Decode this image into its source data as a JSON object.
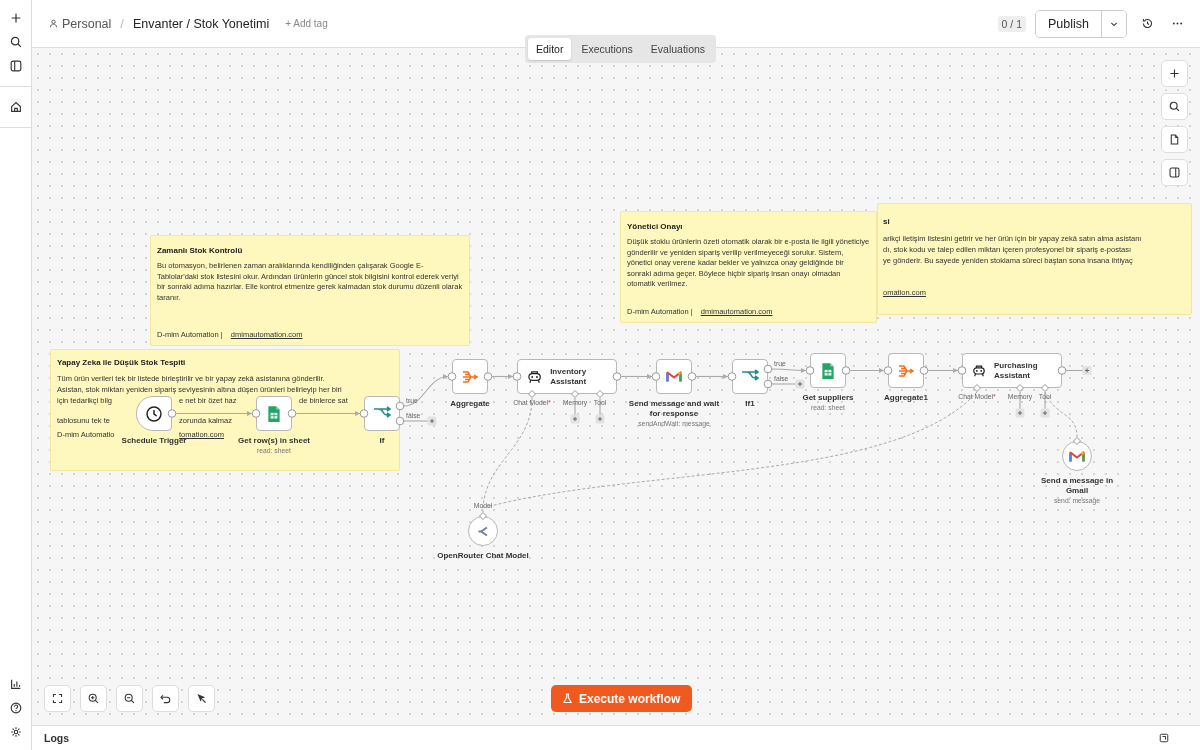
{
  "breadcrumb": {
    "project": "Personal",
    "separator": "/",
    "workflow": "Envanter / Stok Yonetimi",
    "add_tag": "+ Add tag"
  },
  "header": {
    "version": "0 / 1",
    "publish_label": "Publish"
  },
  "tabs": [
    {
      "label": "Editor",
      "selected": true
    },
    {
      "label": "Executions",
      "selected": false
    },
    {
      "label": "Evaluations",
      "selected": false
    }
  ],
  "sticky_notes": [
    {
      "kind": "full",
      "title": "Zamanlı Stok Kontrolü",
      "body": "Bu otomasyon, belirlenen zaman aralıklarında kendiliğinden çalışarak Google E-Tablolar'daki stok listesini okur. Ardından ürünlerin güncel stok bilgisini kontrol ederek veriyi bir sonraki adıma hazırlar. Elle kontrol etmenize gerek kalmadan stok durumu düzenli olarak taranır.",
      "signature": "D-mim Automation |",
      "link": "dmimautomation.com"
    },
    {
      "kind": "covered",
      "title": "Yapay Zeka ile Düşük Stok Tespiti",
      "lines": [
        [
          "Tüm ürün verileri tek bir listede birleştirilir ve bir yapay zekâ asistanına gönderilir."
        ],
        [
          "Asistan, stok miktarı yeniden sipariş seviyesinin altına düşen ürünleri belirleyip her biri"
        ],
        [
          "için tedarikçi bilg",
          "e net bir özet haz",
          "de binlerce sat"
        ],
        [
          "tablosunu tek te",
          "zorunda kalmaz"
        ]
      ],
      "signature": "D-mim Automatio",
      "link": "tomation.com"
    },
    {
      "kind": "full",
      "title": "Yönetici Onayı",
      "body": "Düşük stoklu ürünlerin özeti otomatik olarak bir e-posta ile ilgili yöneticiye gönderilir ve yeniden sipariş verilip verilmeyeceği sorulur. Sistem, yönetici onay verene kadar bekler ve yalnızca onay geldiğinde bir sonraki adıma geçer. Böylece hiçbir sipariş insan onayı olmadan otomatik verilmez.",
      "signature": "D-mim Automation |",
      "link": "dmimautomation.com"
    },
    {
      "kind": "covered",
      "title": "si",
      "lines": [
        [
          "arikçi iletişim listesini getirir ve her ürün için bir yapay zekâ satın alma asistanı"
        ],
        [
          "dı, stok kodu ve talep edilen miktarı içeren profesyonel bir sipariş e-postası"
        ],
        [
          "ye gönderir. Bu sayede yeniden stoklama süreci baştan sona insana ihtiyaç"
        ]
      ],
      "link": "omation.com"
    }
  ],
  "nodes": [
    {
      "kind": "trigger",
      "label": "Schedule Trigger"
    },
    {
      "kind": "sheets",
      "label": "Get row(s) in sheet",
      "subtitle": "read: sheet"
    },
    {
      "kind": "if",
      "label": "If",
      "output_labels": [
        "true",
        "false"
      ]
    },
    {
      "kind": "aggregate",
      "label": "Aggregate"
    },
    {
      "kind": "agent",
      "label": "Inventory Assistant",
      "sub_ports": [
        {
          "label": "Chat Model",
          "mark": "*"
        },
        {
          "label": "Memory"
        },
        {
          "label": "Tool"
        }
      ]
    },
    {
      "kind": "gmail",
      "label": "Send message and wait for response",
      "subtitle": "sendAndWait: message"
    },
    {
      "kind": "if",
      "label": "If1",
      "output_labels": [
        "true",
        "false"
      ]
    },
    {
      "kind": "sheets",
      "label": "Get suppliers",
      "subtitle": "read: sheet"
    },
    {
      "kind": "aggregate",
      "label": "Aggregate1"
    },
    {
      "kind": "agent",
      "label": "Purchasing Assistant",
      "sub_ports": [
        {
          "label": "Chat Model",
          "mark": "*"
        },
        {
          "label": "Memory"
        },
        {
          "label": "Tool"
        }
      ]
    },
    {
      "kind": "model",
      "label": "OpenRouter Chat Model",
      "input_label": "Model"
    },
    {
      "kind": "gmail-tool",
      "label": "Send a message in Gmail",
      "subtitle": "send: message"
    }
  ],
  "execute_button": "Execute workflow",
  "logs_bar": {
    "title": "Logs"
  }
}
